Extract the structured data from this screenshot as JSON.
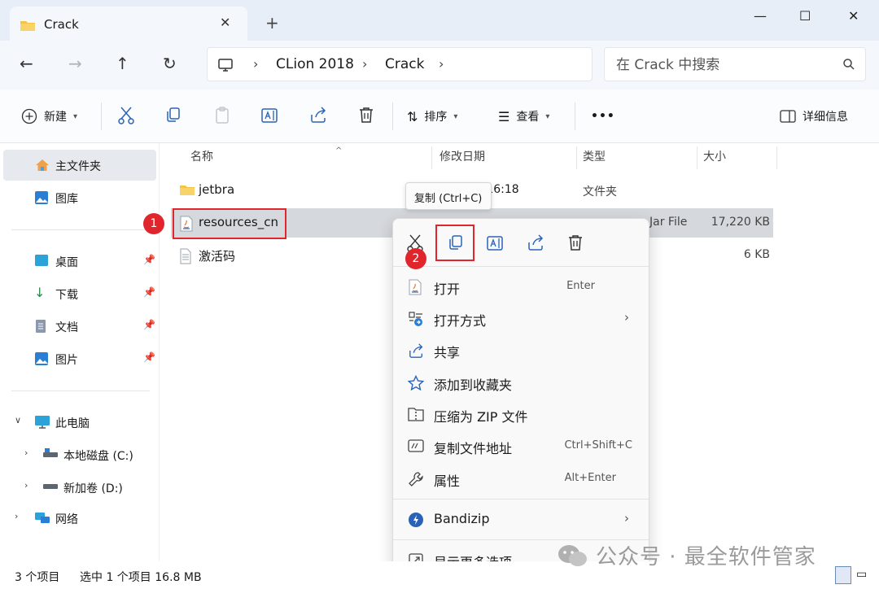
{
  "tab": {
    "title": "Crack",
    "close": "✕"
  },
  "window": {
    "newtab": "+",
    "minimize": "—",
    "maximize": "☐",
    "close": "✕"
  },
  "breadcrumb": [
    "CLion 2018",
    "Crack"
  ],
  "search": {
    "placeholder": "在 Crack 中搜索"
  },
  "toolbar": {
    "new_label": "新建",
    "sort_label": "排序",
    "view_label": "查看",
    "more_label": "•••",
    "details_label": "详细信息"
  },
  "sidebar": {
    "home": "主文件夹",
    "gallery": "图库",
    "desktop": "桌面",
    "downloads": "下载",
    "documents": "文档",
    "pictures": "图片",
    "this_pc": "此电脑",
    "local_disk": "本地磁盘 (C:)",
    "new_volume": "新加卷 (D:)",
    "network": "网络"
  },
  "columns": {
    "name": "名称",
    "modified": "修改日期",
    "type": "类型",
    "size": "大小"
  },
  "files": [
    {
      "name": "jetbra",
      "date": "3 16:18",
      "type": "文件夹",
      "size": ""
    },
    {
      "name": "resources_cn",
      "date": "",
      "type": "Jar File",
      "size": "17,220 KB"
    },
    {
      "name": "激活码",
      "date": "",
      "type": "",
      "size": "6 KB"
    }
  ],
  "badges": {
    "one": "1",
    "two": "2"
  },
  "tooltip": "复制 (Ctrl+C)",
  "context_menu": {
    "open": {
      "label": "打开",
      "shortcut": "Enter"
    },
    "open_with": {
      "label": "打开方式"
    },
    "share": {
      "label": "共享"
    },
    "favorite": {
      "label": "添加到收藏夹"
    },
    "zip": {
      "label": "压缩为 ZIP 文件"
    },
    "copy_path": {
      "label": "复制文件地址",
      "shortcut": "Ctrl+Shift+C"
    },
    "properties": {
      "label": "属性",
      "shortcut": "Alt+Enter"
    },
    "bandizip": {
      "label": "Bandizip"
    },
    "more": {
      "label": "显示更多选项"
    }
  },
  "status": {
    "count": "3 个项目",
    "selection": "选中 1 个项目  16.8 MB"
  },
  "watermark": "公众号 · 最全软件管家",
  "colors": {
    "accent": "#0067c0",
    "highlight_red": "#e0262c",
    "folder": "#f4c542"
  }
}
